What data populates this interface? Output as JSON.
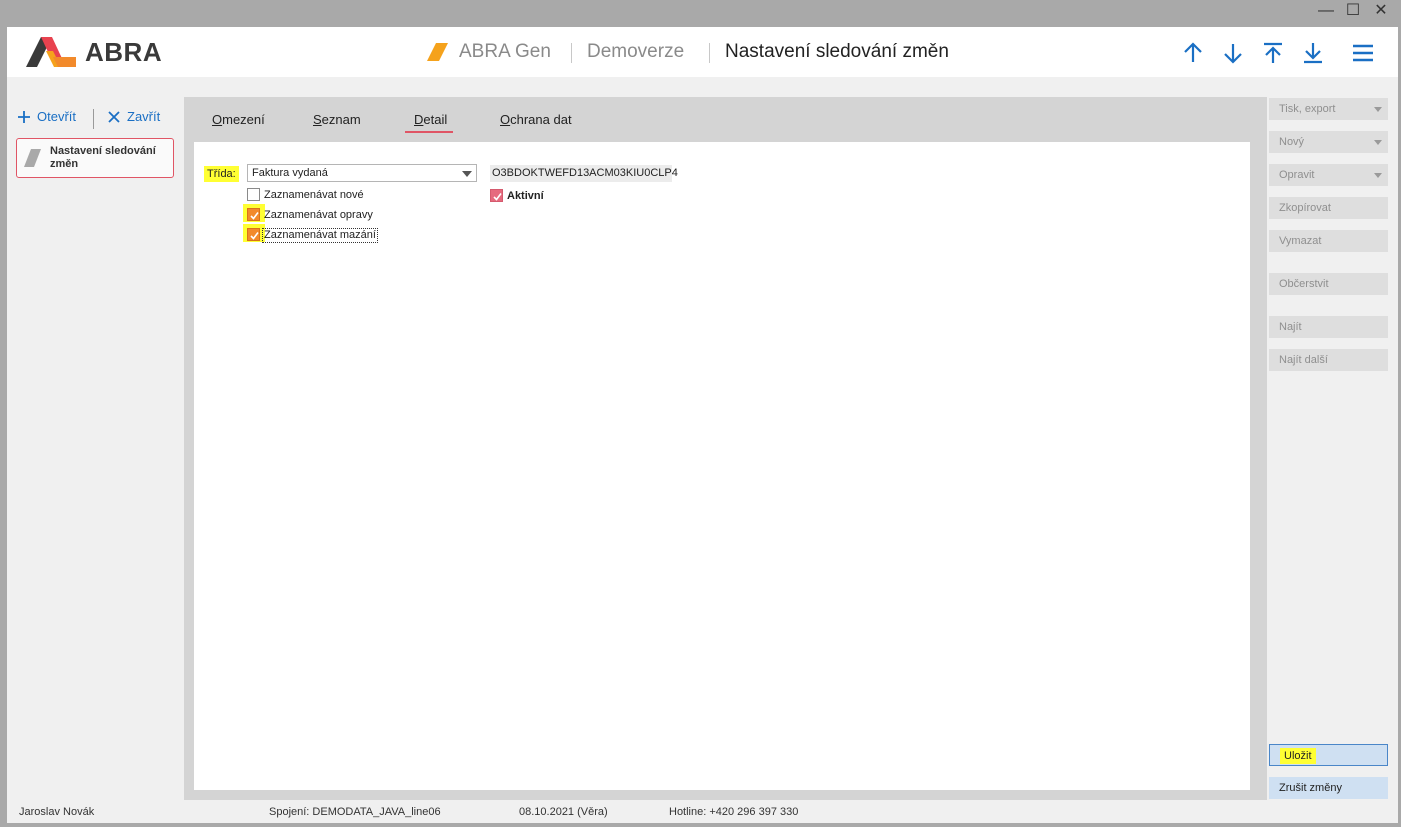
{
  "window": {
    "minimize_glyph": "—",
    "maximize_glyph": "☐",
    "close_glyph": "✕"
  },
  "header": {
    "logo_text": "ABRA",
    "app_name": "ABRA Gen",
    "edition": "Demoverze",
    "page_title": "Nastavení sledování změn",
    "nav_icons": [
      "arrow-up-icon",
      "arrow-down-icon",
      "arrow-to-top-icon",
      "arrow-to-bottom-icon",
      "menu-icon"
    ]
  },
  "leftbar": {
    "open_label": "Otevřít",
    "close_label": "Zavřít",
    "open_item_label": "Nastavení sledování změn"
  },
  "tabs": [
    {
      "label": "Omezení",
      "active": false
    },
    {
      "label": "Seznam",
      "active": false
    },
    {
      "label": "Detail",
      "active": true
    },
    {
      "label": "Ochrana dat",
      "active": false
    }
  ],
  "detail": {
    "class_label": "Třída:",
    "class_value": "Faktura vydaná",
    "record_id": "O3BDOKTWEFD13ACM03KIU0CLP4",
    "active_label": "Aktivní",
    "active_checked": true,
    "checkboxes": [
      {
        "label": "Zaznamenávat nové",
        "checked": false
      },
      {
        "label": "Zaznamenávat opravy",
        "checked": true
      },
      {
        "label": "Zaznamenávat mazání",
        "checked": true
      }
    ]
  },
  "actions": {
    "print_export": "Tisk, export",
    "new": "Nový",
    "edit": "Opravit",
    "copy": "Zkopírovat",
    "delete": "Vymazat",
    "refresh": "Občerstvit",
    "find": "Najít",
    "find_next": "Najít další",
    "save": "Uložit",
    "cancel": "Zrušit změny"
  },
  "status": {
    "user": "Jaroslav Novák",
    "connection": "Spojení: DEMODATA_JAVA_line06",
    "date": "08.10.2021 (Věra)",
    "hotline": "Hotline: +420 296 397 330"
  },
  "colors": {
    "accent_blue": "#1a6fc4",
    "brand_orange": "#f28a2b",
    "accent_pink": "#e05565",
    "highlight_yellow": "#ffff33"
  }
}
